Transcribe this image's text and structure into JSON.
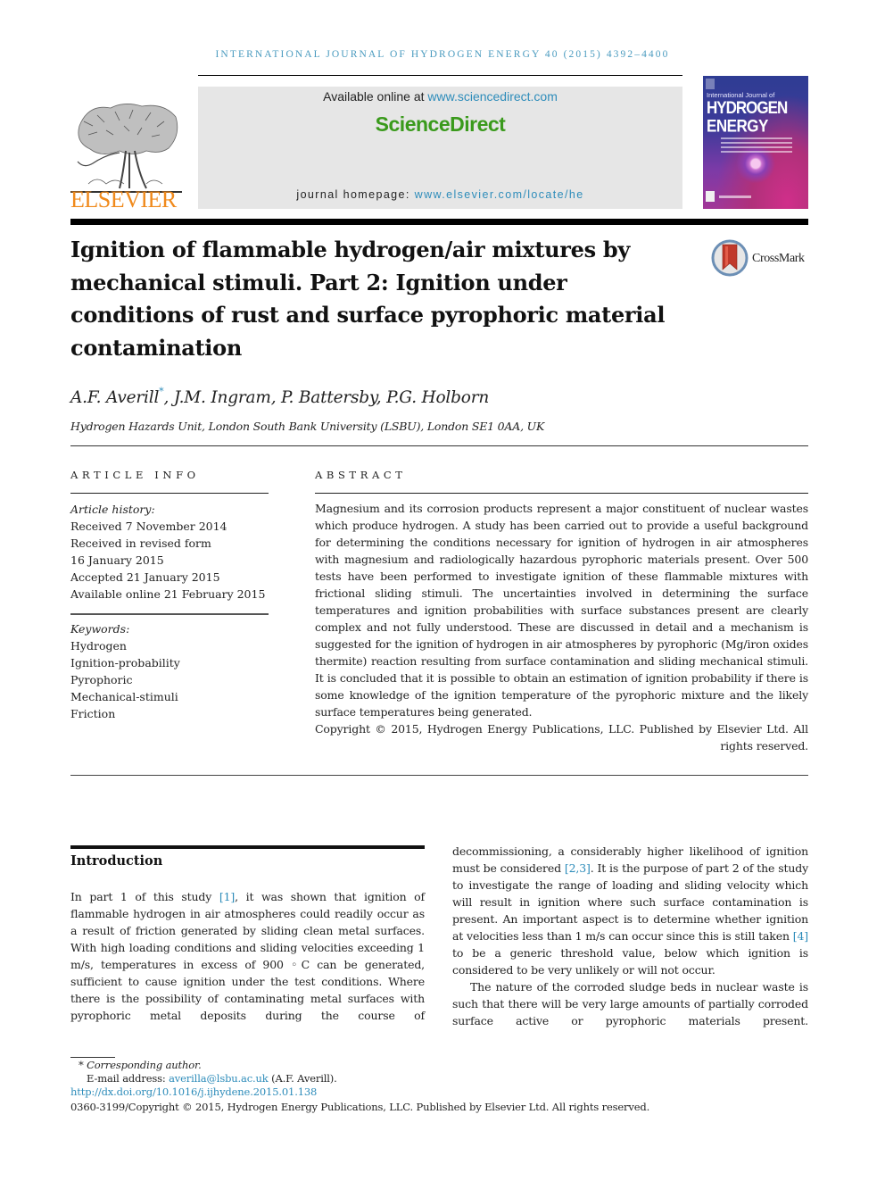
{
  "running_head": "INTERNATIONAL JOURNAL OF HYDROGEN ENERGY 40 (2015) 4392–4400",
  "masthead": {
    "publisher_logo_text": "ELSEVIER",
    "available_prefix": "Available online at ",
    "available_link": "www.sciencedirect.com",
    "brand": "ScienceDirect",
    "homepage_prefix": "journal homepage: ",
    "homepage_link": "www.elsevier.com/locate/he",
    "cover": {
      "small_text": "International Journal of",
      "title_line1": "HYDROGEN",
      "title_line2": "ENERGY"
    },
    "colors": {
      "brand_green": "#3a9a1c",
      "link_blue": "#2d8cba",
      "elsevier_orange": "#f08a1c"
    }
  },
  "article": {
    "title": "Ignition of flammable hydrogen/air mixtures by mechanical stimuli. Part 2: Ignition under conditions of rust and surface pyrophoric material contamination",
    "crossmark_label": "CrossMark",
    "authors": {
      "first": "A.F. Averill",
      "first_marker": "*",
      "rest": ", J.M. Ingram, P. Battersby, P.G. Holborn"
    },
    "affiliation": "Hydrogen Hazards Unit, London South Bank University (LSBU), London SE1 0AA, UK"
  },
  "article_info": {
    "label": "ARTICLE INFO",
    "history_heading": "Article history:",
    "history": [
      "Received 7 November 2014",
      "Received in revised form",
      "16 January 2015",
      "Accepted 21 January 2015",
      "Available online 21 February 2015"
    ],
    "keywords_heading": "Keywords:",
    "keywords": [
      "Hydrogen",
      "Ignition-probability",
      "Pyrophoric",
      "Mechanical-stimuli",
      "Friction"
    ]
  },
  "abstract": {
    "label": "ABSTRACT",
    "text": "Magnesium and its corrosion products represent a major constituent of nuclear wastes which produce hydrogen. A study has been carried out to provide a useful background for determining the conditions necessary for ignition of hydrogen in air atmospheres with magnesium and radiologically hazardous pyrophoric materials present. Over 500 tests have been performed to investigate ignition of these flammable mixtures with frictional sliding stimuli. The uncertainties involved in determining the surface temperatures and ignition probabilities with surface substances present are clearly complex and not fully understood. These are discussed in detail and a mechanism is suggested for the ignition of hydrogen in air atmospheres by pyrophoric (Mg/iron oxides thermite) reaction resulting from surface contamination and sliding mechanical stimuli. It is concluded that it is possible to obtain an estimation of ignition probability if there is some knowledge of the ignition temperature of the pyrophoric mixture and the likely surface temperatures being generated.",
    "copyright": "Copyright © 2015, Hydrogen Energy Publications, LLC. Published by Elsevier Ltd. All rights reserved."
  },
  "introduction": {
    "heading": "Introduction",
    "left_p1_a": "In part 1 of this study ",
    "left_p1_ref1": "[1]",
    "left_p1_b": ", it was shown that ignition of flammable hydrogen in air atmospheres could readily occur as a result of friction generated by sliding clean metal surfaces. With high loading conditions and sliding velocities exceeding 1 m/s, temperatures in excess of 900 ◦C can be generated, sufficient to cause ignition under the test conditions. Where there is the possibility of contaminating metal surfaces with pyrophoric metal deposits during the course of",
    "right_p1_a": "decommissioning, a considerably higher likelihood of ignition must be considered ",
    "right_p1_ref23": "[2,3]",
    "right_p1_b": ". It is the purpose of part 2 of the study to investigate the range of loading and sliding velocity which will result in ignition where such surface contamination is present. An important aspect is to determine whether ignition at velocities less than 1 m/s can occur since this is still taken ",
    "right_p1_ref4": "[4]",
    "right_p1_c": " to be a generic threshold value, below which ignition is considered to be very unlikely or will not occur.",
    "right_p2": "The nature of the corroded sludge beds in nuclear waste is such that there will be very large amounts of partially corroded surface active or pyrophoric materials present."
  },
  "footnotes": {
    "corresponding": "* Corresponding author.",
    "email_prefix": "E-mail address: ",
    "email": "averilla@lsbu.ac.uk",
    "email_suffix": " (A.F. Averill).",
    "doi": "http://dx.doi.org/10.1016/j.ijhydene.2015.01.138",
    "issn_copyright": "0360-3199/Copyright © 2015, Hydrogen Energy Publications, LLC. Published by Elsevier Ltd. All rights reserved."
  }
}
